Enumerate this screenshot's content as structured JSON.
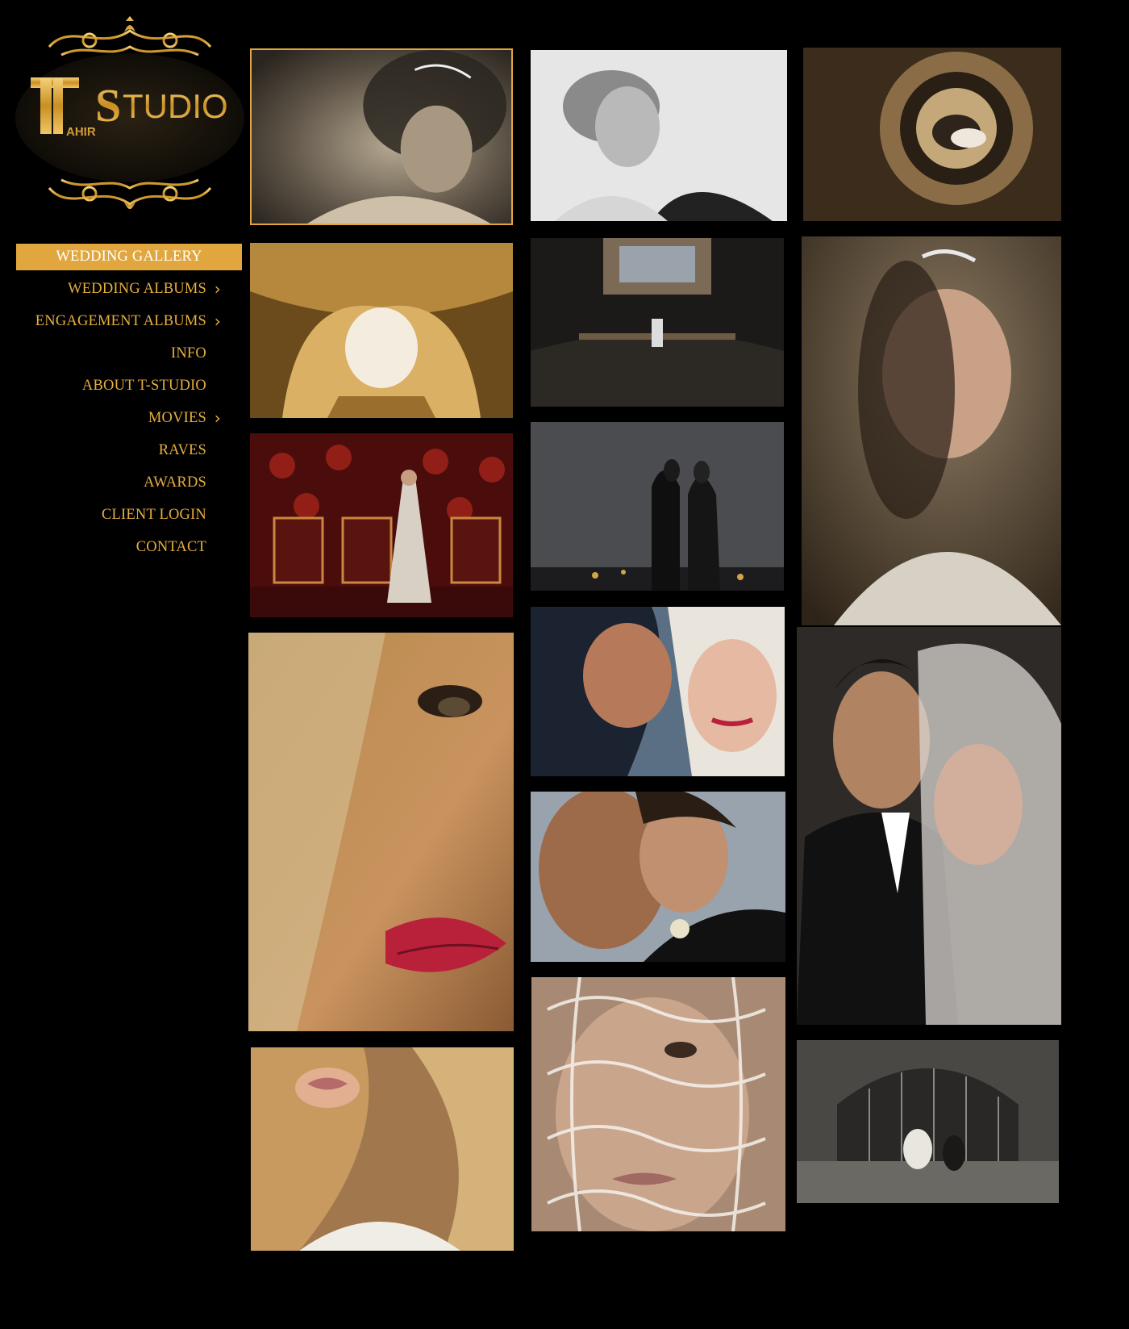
{
  "brand": {
    "logo_text": "T STUDIO",
    "logo_alt": "Tahir T-Studio logo",
    "colors": {
      "gold": "#e1a73e",
      "gold_text": "#e7ae3f",
      "background": "#000000"
    }
  },
  "nav": {
    "items": [
      {
        "label": "WEDDING GALLERY",
        "active": true,
        "has_submenu": false
      },
      {
        "label": "WEDDING ALBUMS",
        "active": false,
        "has_submenu": true
      },
      {
        "label": "ENGAGEMENT ALBUMS",
        "active": false,
        "has_submenu": true
      },
      {
        "label": "INFO",
        "active": false,
        "has_submenu": false
      },
      {
        "label": "ABOUT T-STUDIO",
        "active": false,
        "has_submenu": false
      },
      {
        "label": "MOVIES",
        "active": false,
        "has_submenu": true
      },
      {
        "label": "RAVES",
        "active": false,
        "has_submenu": false
      },
      {
        "label": "AWARDS",
        "active": false,
        "has_submenu": false
      },
      {
        "label": "CLIENT LOGIN",
        "active": false,
        "has_submenu": false
      },
      {
        "label": "CONTACT",
        "active": false,
        "has_submenu": false
      }
    ],
    "submenu_icon": "chevron-right-icon"
  },
  "gallery": {
    "selected_index": 0,
    "photos": [
      {
        "id": "bride-headpiece-sepia",
        "col": 1
      },
      {
        "id": "woman-profile-bw",
        "col": 2
      },
      {
        "id": "spiral-staircase-couple",
        "col": 3
      },
      {
        "id": "gold-staircase-hall",
        "col": 1
      },
      {
        "id": "dark-ornate-hall",
        "col": 2
      },
      {
        "id": "bride-portrait-color",
        "col": 3
      },
      {
        "id": "bride-red-chairs",
        "col": 1
      },
      {
        "id": "couple-rain-night",
        "col": 2
      },
      {
        "id": "bride-eye-closeup",
        "col": 1
      },
      {
        "id": "couple-smiling",
        "col": 2
      },
      {
        "id": "groom-bride-veil",
        "col": 3
      },
      {
        "id": "couple-cheek",
        "col": 2
      },
      {
        "id": "bride-lips-blonde",
        "col": 1
      },
      {
        "id": "lace-veil-face",
        "col": 2
      },
      {
        "id": "church-window-party",
        "col": 3
      }
    ]
  }
}
